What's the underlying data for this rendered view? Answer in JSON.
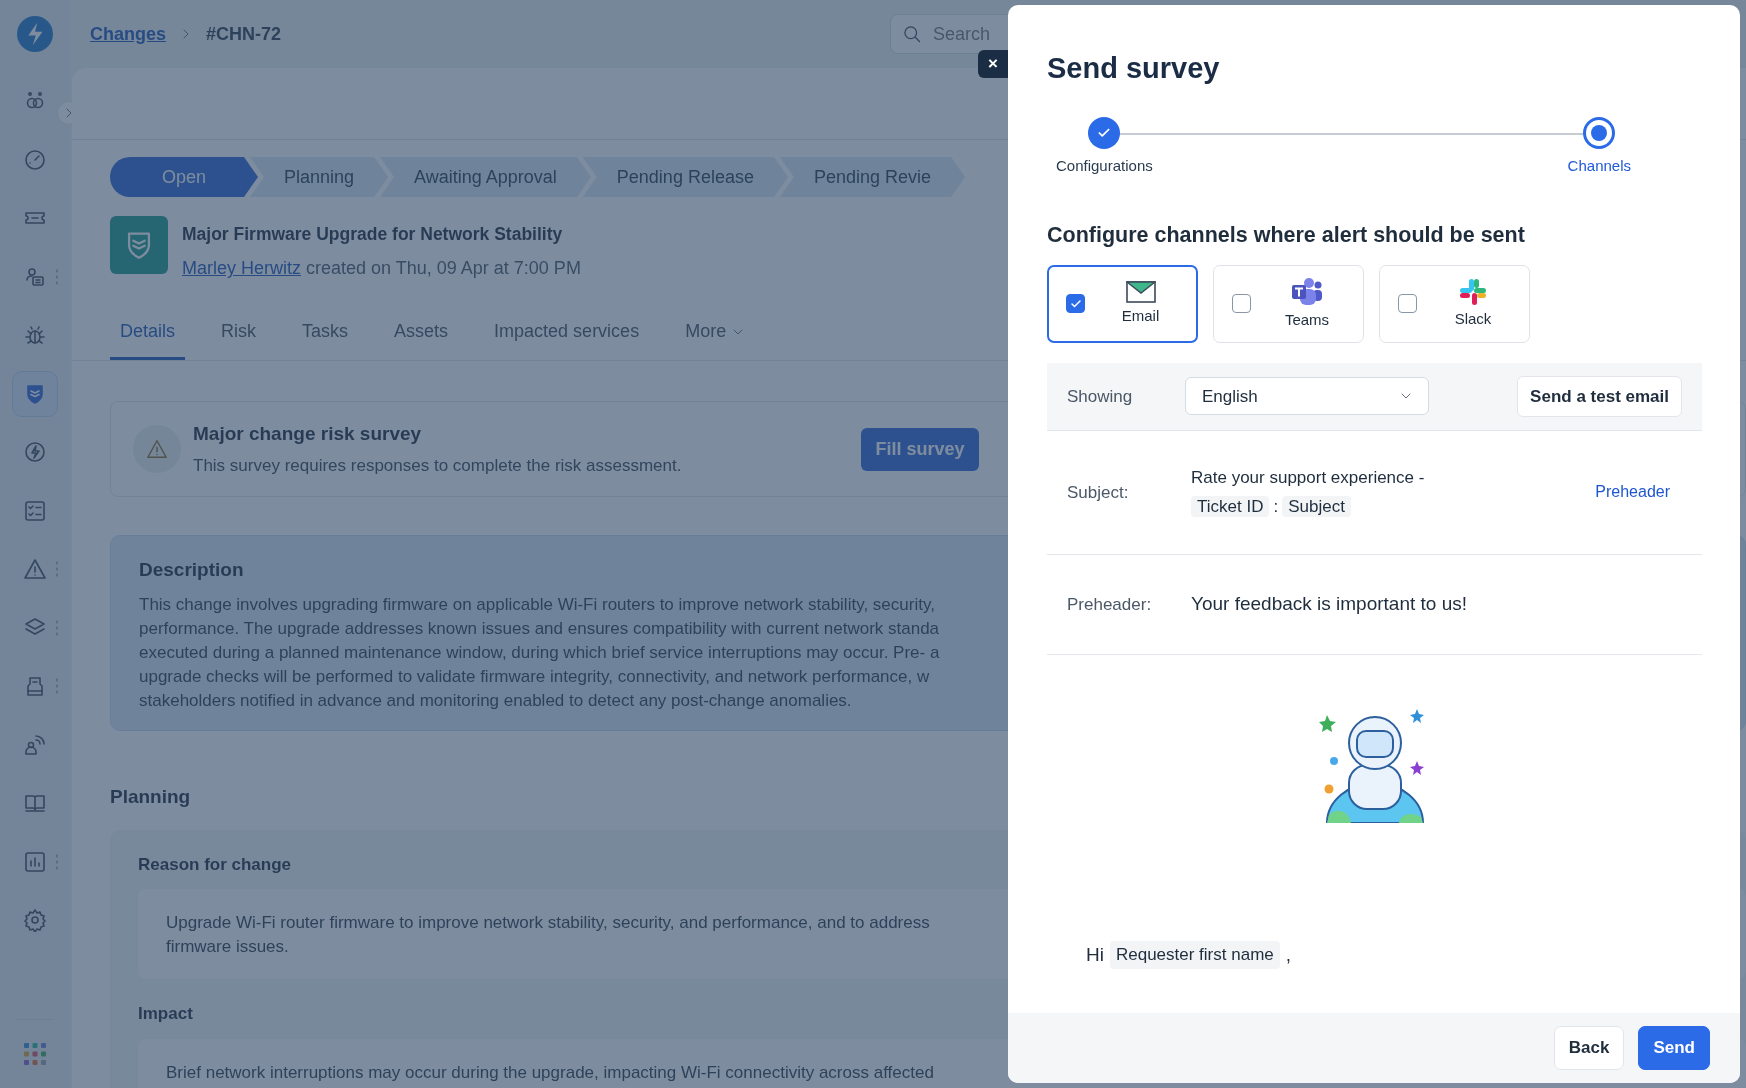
{
  "sidebar": {
    "items": [
      {
        "selected": false,
        "has_menu": false
      },
      {
        "selected": false,
        "has_menu": false
      },
      {
        "selected": false,
        "has_menu": false
      },
      {
        "selected": false,
        "has_menu": true
      },
      {
        "selected": false,
        "has_menu": false
      },
      {
        "selected": true,
        "has_menu": false
      },
      {
        "selected": false,
        "has_menu": false
      },
      {
        "selected": false,
        "has_menu": false
      },
      {
        "selected": false,
        "has_menu": true
      },
      {
        "selected": false,
        "has_menu": true
      },
      {
        "selected": false,
        "has_menu": true
      },
      {
        "selected": false,
        "has_menu": false
      },
      {
        "selected": false,
        "has_menu": false
      },
      {
        "selected": false,
        "has_menu": true
      },
      {
        "selected": false,
        "has_menu": false
      }
    ]
  },
  "breadcrumb": [
    {
      "text": "Changes",
      "kind": "link"
    },
    {
      "text": "#CHN-72",
      "kind": "current"
    }
  ],
  "search": {
    "placeholder": "Search"
  },
  "close_button": "×",
  "stages": [
    {
      "label": "Open",
      "selected": true
    },
    {
      "label": "Planning",
      "selected": false
    },
    {
      "label": "Awaiting Approval",
      "selected": false
    },
    {
      "label": "Pending Release",
      "selected": false
    },
    {
      "label": "Pending Revie",
      "selected": false
    }
  ],
  "change": {
    "title": "Major Firmware Upgrade for Network Stability",
    "author": "Marley Herwitz",
    "created": "created on Thu, 09 Apr at 7:00 PM"
  },
  "tabs": [
    {
      "label": "Details",
      "selected": true
    },
    {
      "label": "Risk",
      "selected": false
    },
    {
      "label": "Tasks",
      "selected": false
    },
    {
      "label": "Assets",
      "selected": false
    },
    {
      "label": "Impacted services",
      "selected": false
    },
    {
      "label": "More",
      "selected": false,
      "kind": "dropdown"
    }
  ],
  "survey_banner": {
    "title": "Major change risk survey",
    "text": "This survey requires responses to complete the risk assessment.",
    "button": "Fill survey"
  },
  "description": {
    "title": "Description",
    "lines": [
      "This change involves upgrading firmware on applicable Wi-Fi routers to improve network stability, security,",
      "performance. The upgrade addresses known issues and ensures compatibility with current network standa",
      "executed during a planned maintenance window, during which brief service interruptions may occur. Pre- a",
      "upgrade checks will be performed to validate firmware integrity, connectivity, and network performance, w",
      "stakeholders notified in advance and monitoring enabled to detect any post-change anomalies."
    ]
  },
  "planning": {
    "title": "Planning",
    "fields": [
      {
        "label": "Reason for change",
        "lines": [
          "Upgrade Wi-Fi router firmware to improve network stability, security, and performance, and to address",
          "firmware issues."
        ]
      },
      {
        "label": "Impact",
        "lines": [
          "Brief network interruptions may occur during the upgrade, impacting Wi-Fi connectivity across affected"
        ]
      }
    ]
  },
  "modal": {
    "title": "Send survey",
    "steps": [
      {
        "label": "Configurations",
        "completed": true,
        "selected": false
      },
      {
        "label": "Channels",
        "completed": false,
        "selected": true
      }
    ],
    "heading": "Configure channels where alert should be sent",
    "channels": [
      {
        "label": "Email",
        "kind": "email",
        "checked": true
      },
      {
        "label": "Teams",
        "kind": "teams",
        "checked": false
      },
      {
        "label": "Slack",
        "kind": "slack",
        "checked": false
      }
    ],
    "showing": {
      "label": "Showing",
      "value": "English",
      "test_button": "Send a test email"
    },
    "subject": {
      "label": "Subject:",
      "text": "Rate your support experience -",
      "tokens": [
        {
          "kind": "placeholder",
          "text": "Ticket ID"
        },
        {
          "kind": "separator",
          "text": ":"
        },
        {
          "kind": "placeholder",
          "text": "Subject"
        }
      ],
      "link": "Preheader"
    },
    "preheader": {
      "label": "Preheader:",
      "value": "Your feedback is important to us!"
    },
    "greeting": [
      {
        "kind": "text",
        "text": "Hi"
      },
      {
        "kind": "placeholder",
        "text": "Requester first name"
      },
      {
        "kind": "text",
        "text": ","
      }
    ],
    "buttons": [
      {
        "label": "Back",
        "kind": "secondary"
      },
      {
        "label": "Send",
        "kind": "primary"
      }
    ]
  }
}
